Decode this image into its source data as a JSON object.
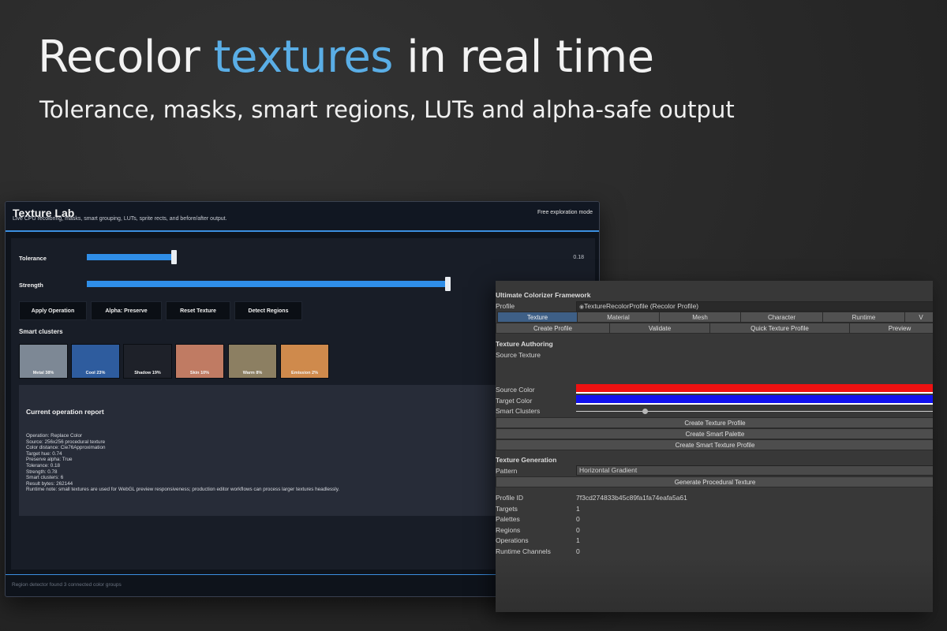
{
  "hero": {
    "title_before": "Recolor ",
    "title_accent": "textures",
    "title_after": " in real time",
    "subtitle": "Tolerance, masks, smart regions, LUTs and alpha-safe output"
  },
  "lab": {
    "title": "Texture Lab",
    "subtitle": "Live CPU recoloring, masks, smart grouping, LUTs, sprite rects, and before/after output.",
    "mode": "Free exploration mode",
    "sliders": [
      {
        "label": "Tolerance",
        "value_text": "0.18",
        "level": 0.24
      },
      {
        "label": "Strength",
        "value_text": "",
        "level": 1.0
      }
    ],
    "buttons": [
      "Apply Operation",
      "Alpha: Preserve",
      "Reset Texture",
      "Detect Regions"
    ],
    "clusters_heading": "Smart clusters",
    "clusters": [
      {
        "label": "Metal 38%",
        "color": "#7d8895"
      },
      {
        "label": "Cool 23%",
        "color": "#2e5c9e"
      },
      {
        "label": "Shadow 19%",
        "color": "#1e2129"
      },
      {
        "label": "Skin 10%",
        "color": "#c07b63"
      },
      {
        "label": "Warm 8%",
        "color": "#8c7f62"
      },
      {
        "label": "Emission 2%",
        "color": "#cf8a4c"
      }
    ],
    "report_title": "Current operation report",
    "report_lines": [
      "Operation: Replace Color",
      "Source: 256x256 procedural texture",
      "Color distance: Cie76Approximation",
      "Target hue: 0.74",
      "Preserve alpha: True",
      "Tolerance: 0.18",
      "Strength: 0.78",
      "Smart clusters: 6",
      "Result bytes: 262144",
      "Runtime note: small textures are used for WebGL preview responsiveness; production editor workflows can process larger textures headlessly."
    ],
    "footer": "Region detector found 3 connected color groups"
  },
  "inspector": {
    "title": "Ultimate Colorizer Framework",
    "profile_label": "Profile",
    "profile_value": "TextureRecolorProfile (Recolor Profile)",
    "tabs": [
      "Texture",
      "Material",
      "Mesh",
      "Character",
      "Runtime",
      "V"
    ],
    "actions": [
      "Create Profile",
      "Validate",
      "Quick Texture Profile",
      "Preview"
    ],
    "authoring_heading": "Texture Authoring",
    "source_texture_label": "Source Texture",
    "source_color_label": "Source Color",
    "target_color_label": "Target Color",
    "smart_clusters_label": "Smart Clusters",
    "source_color": "#ee1111",
    "target_color": "#1111ee",
    "smart_clusters_level": 0.19,
    "buttons": [
      "Create Texture Profile",
      "Create Smart Palette",
      "Create Smart Texture Profile"
    ],
    "generation_heading": "Texture Generation",
    "pattern_label": "Pattern",
    "pattern_value": "Horizontal Gradient",
    "generate_button": "Generate Procedural Texture",
    "stats": [
      {
        "label": "Profile ID",
        "value": "7f3cd274833b45c89fa1fa74eafa5a61"
      },
      {
        "label": "Targets",
        "value": "1"
      },
      {
        "label": "Palettes",
        "value": "0"
      },
      {
        "label": "Regions",
        "value": "0"
      },
      {
        "label": "Operations",
        "value": "1"
      },
      {
        "label": "Runtime Channels",
        "value": "0"
      }
    ]
  }
}
